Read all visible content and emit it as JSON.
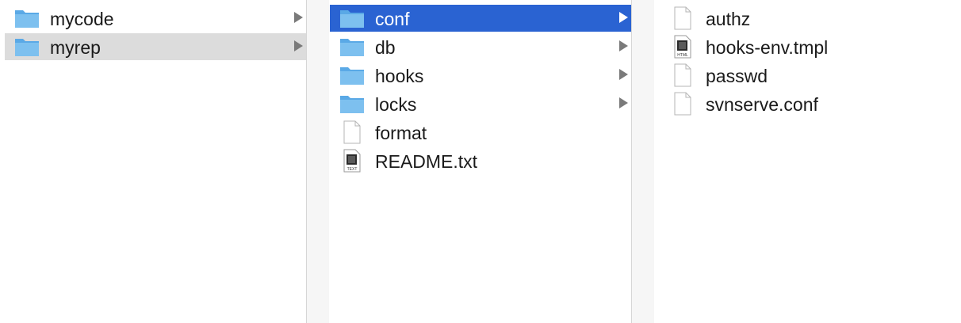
{
  "columns": [
    {
      "items": [
        {
          "name": "mycode",
          "kind": "folder",
          "has_children": true,
          "state": "normal"
        },
        {
          "name": "myrep",
          "kind": "folder",
          "has_children": true,
          "state": "highlighted"
        }
      ]
    },
    {
      "items": [
        {
          "name": "conf",
          "kind": "folder",
          "has_children": true,
          "state": "selected"
        },
        {
          "name": "db",
          "kind": "folder",
          "has_children": true,
          "state": "normal"
        },
        {
          "name": "hooks",
          "kind": "folder",
          "has_children": true,
          "state": "normal"
        },
        {
          "name": "locks",
          "kind": "folder",
          "has_children": true,
          "state": "normal"
        },
        {
          "name": "format",
          "kind": "document",
          "has_children": false,
          "state": "normal"
        },
        {
          "name": "README.txt",
          "kind": "document-text",
          "badge": "TEXT",
          "has_children": false,
          "state": "normal"
        }
      ]
    },
    {
      "items": [
        {
          "name": "authz",
          "kind": "document",
          "has_children": false,
          "state": "normal"
        },
        {
          "name": "hooks-env.tmpl",
          "kind": "document-html",
          "badge": "HTML",
          "has_children": false,
          "state": "normal"
        },
        {
          "name": "passwd",
          "kind": "document",
          "has_children": false,
          "state": "normal"
        },
        {
          "name": "svnserve.conf",
          "kind": "document",
          "has_children": false,
          "state": "normal"
        }
      ]
    }
  ],
  "colors": {
    "selection": "#2a63d2",
    "highlight": "#dcdcdc",
    "folder": "#6cb6ea",
    "folder_tab": "#8cc8f0"
  }
}
